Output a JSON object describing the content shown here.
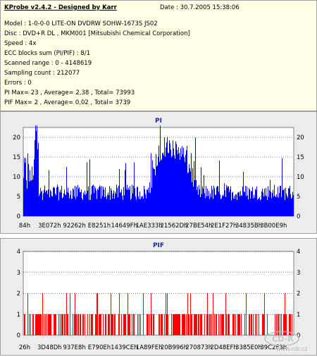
{
  "info": {
    "title": "KProbe v2.4.2 - Designed by Karr",
    "date": "Date : 30.7.2005 15:38:06",
    "lines": [
      "Model : 1-0-0-0 LITE-ON DVDRW SOHW-1673S JS02",
      "Disc : DVD+R DL , MKM001 [Mitsubishi Chemical Corporation]",
      "Speed : 4x",
      "ECC blocks sum (PI/PIF) : 8/1",
      "Scanned range : 0 - 4148619",
      "Sampling count : 212077",
      "Errors : 0",
      "PI Max= 23 , Average= 2,38 , Total= 73993",
      "PIF Max= 2 , Average= 0,02 , Total= 3739"
    ]
  },
  "chart_data": [
    {
      "type": "bar",
      "title": "PI",
      "color": "#0000ff",
      "y_ticks": [
        0,
        5,
        10,
        15,
        20
      ],
      "ylim": [
        0,
        22.5
      ],
      "x_tick_labels": [
        "84h",
        "3E072h",
        "92262h",
        "E8251h",
        "14649Fh",
        "1AE333h",
        "21562Dh",
        "27BE54h",
        "2E1F27h",
        "34835Bh",
        "3B00E9h"
      ],
      "max": 23,
      "average": 2.38,
      "grid": true
    },
    {
      "type": "bar",
      "title": "PIF",
      "color": "#ff0000",
      "y_ticks": [
        0,
        1,
        2,
        3,
        4
      ],
      "ylim": [
        0,
        4
      ],
      "x_tick_labels": [
        "26h",
        "3D48Dh",
        "937E8h",
        "E790Eh",
        "1439CEh",
        "1A89FEh",
        "20B996h",
        "270873h",
        "2D48EFh",
        "3385E0h",
        "39C2F3h"
      ],
      "max": 2,
      "average": 0.02,
      "grid": true
    }
  ],
  "watermark": {
    "logo": "CD-R",
    "url": "www.cdr.cz"
  }
}
